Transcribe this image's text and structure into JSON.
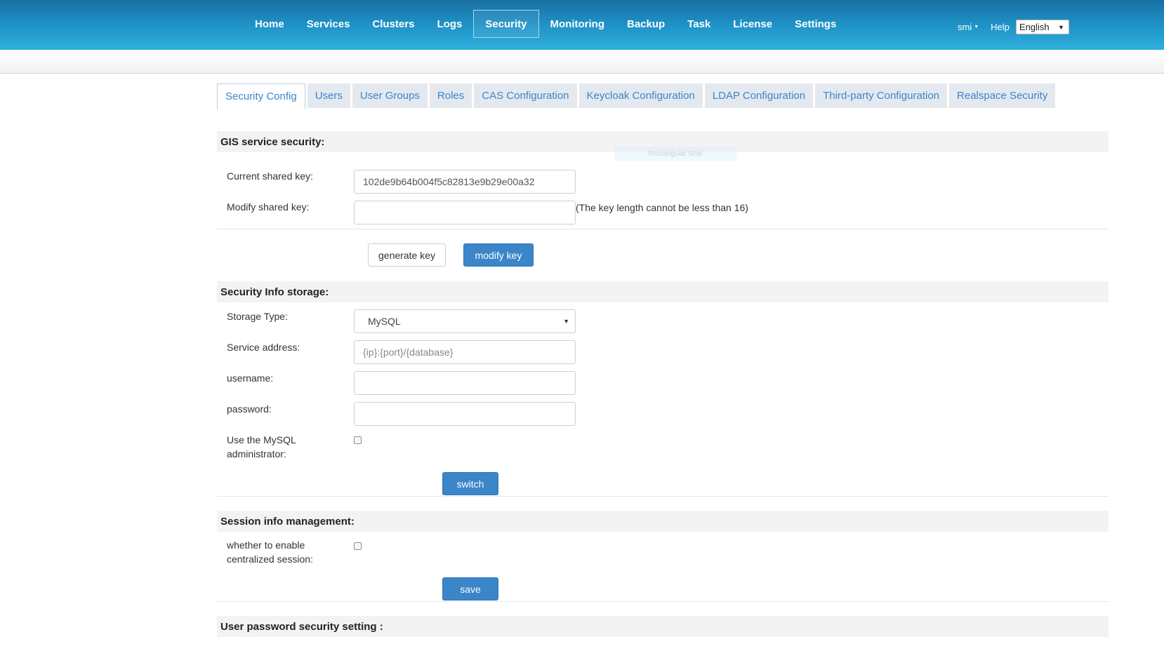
{
  "nav": {
    "items": [
      {
        "label": "Home"
      },
      {
        "label": "Services"
      },
      {
        "label": "Clusters"
      },
      {
        "label": "Logs"
      },
      {
        "label": "Security"
      },
      {
        "label": "Monitoring"
      },
      {
        "label": "Backup"
      },
      {
        "label": "Task"
      },
      {
        "label": "License"
      },
      {
        "label": "Settings"
      }
    ],
    "active": "Security",
    "user": "smi",
    "help": "Help",
    "language": "English"
  },
  "tabs": {
    "items": [
      {
        "label": "Security Config"
      },
      {
        "label": "Users"
      },
      {
        "label": "User Groups"
      },
      {
        "label": "Roles"
      },
      {
        "label": "CAS Configuration"
      },
      {
        "label": "Keycloak Configuration"
      },
      {
        "label": "LDAP Configuration"
      },
      {
        "label": "Third-party Configuration"
      },
      {
        "label": "Realspace Security"
      }
    ],
    "active": "Security Config"
  },
  "overlay": {
    "label": "Rectangular Snip"
  },
  "gis": {
    "title": "GIS service security:",
    "current_key_label": "Current shared key:",
    "current_key_value": "102de9b64b004f5c82813e9b29e00a32",
    "modify_key_label": "Modify shared key:",
    "modify_key_value": "",
    "key_hint": "(The key length cannot be less than 16)",
    "generate_label": "generate key",
    "modify_label": "modify key"
  },
  "storage": {
    "title": "Security Info storage:",
    "type_label": "Storage Type:",
    "type_value": "MySQL",
    "address_label": "Service address:",
    "address_placeholder": "{ip}:{port}/{database}",
    "username_label": "username:",
    "password_label": "password:",
    "admin_label_line1": "Use the MySQL",
    "admin_label_line2": "administrator:",
    "admin_checked": false,
    "switch_label": "switch"
  },
  "session": {
    "title": "Session info management:",
    "enable_label_line1": "whether to enable",
    "enable_label_line2": "centralized session:",
    "enable_checked": false,
    "save_label": "save"
  },
  "password_security": {
    "title": "User password security setting :"
  }
}
